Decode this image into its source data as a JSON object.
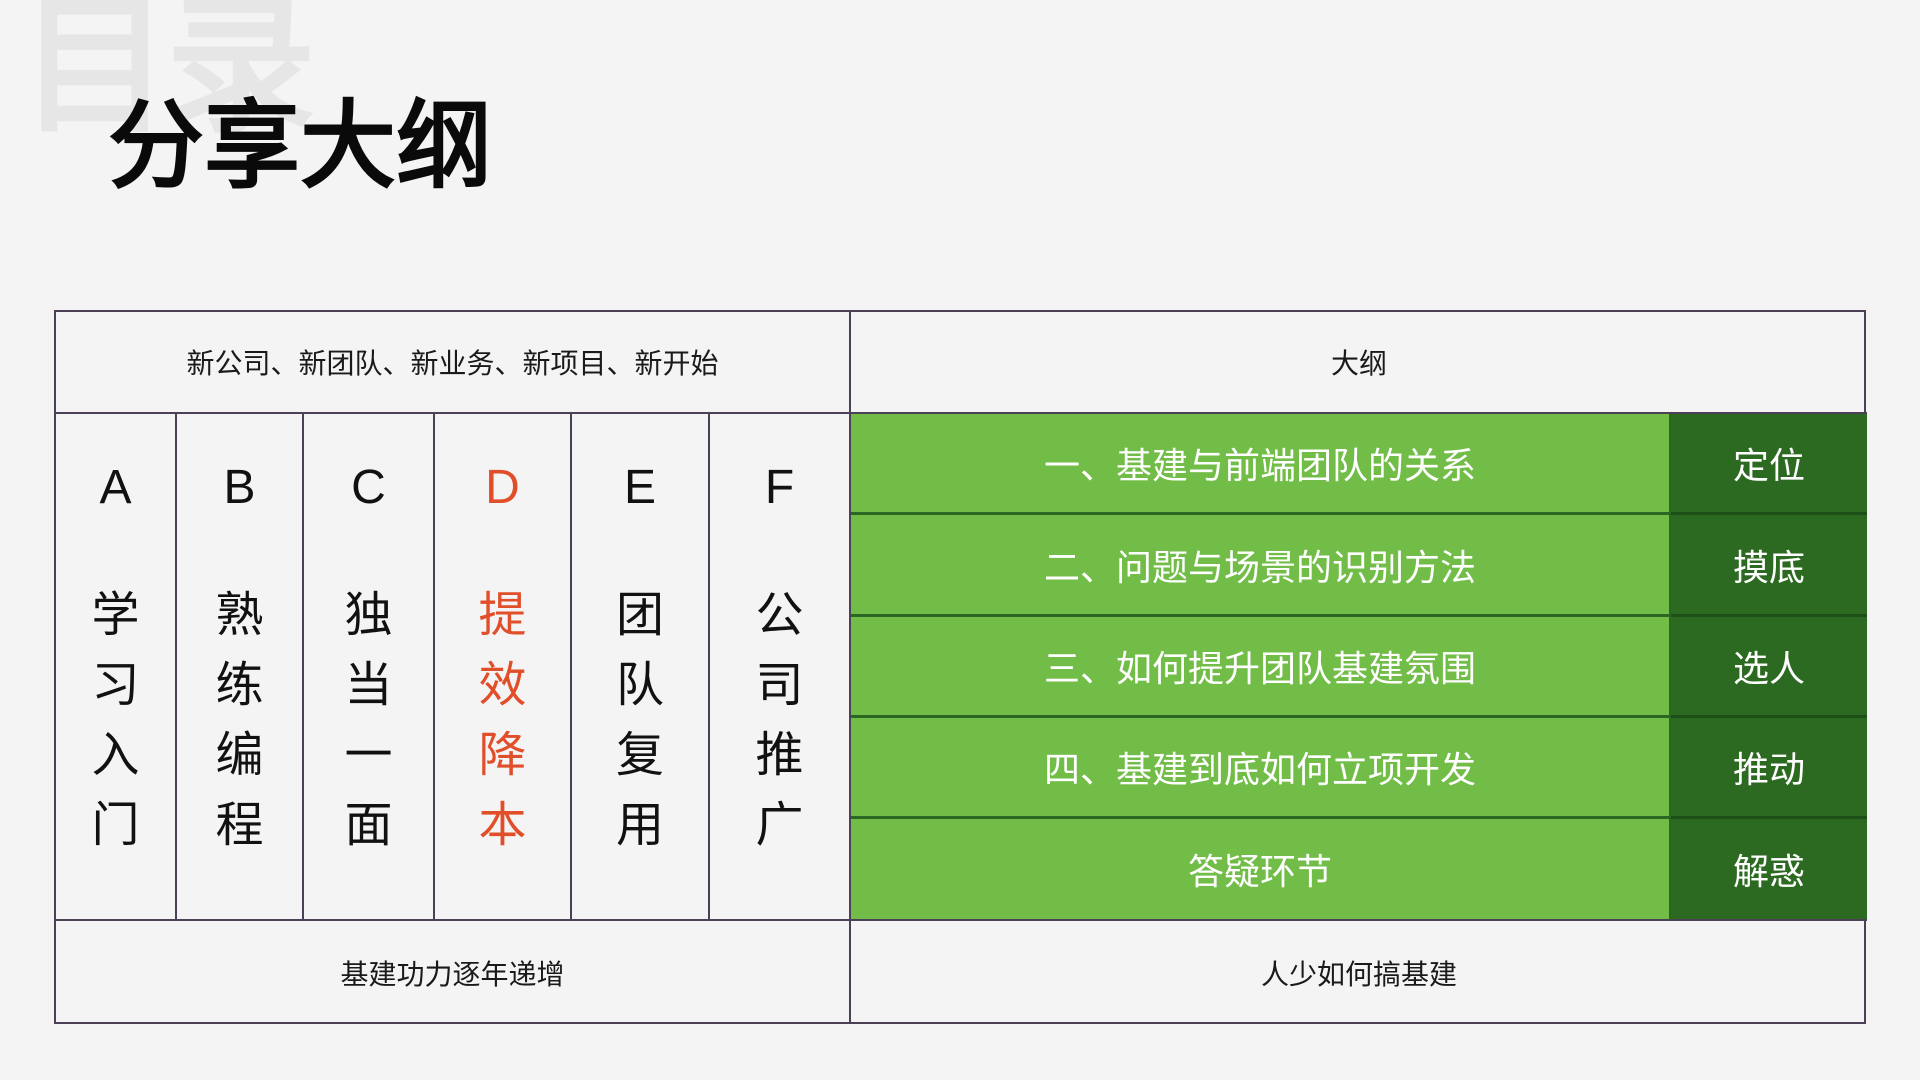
{
  "watermark": "目录",
  "title": "分享大纲",
  "table": {
    "header_left": "新公司、新团队、新业务、新项目、新开始",
    "header_right": "大纲",
    "columns": [
      {
        "letter": "A",
        "chars": [
          "学",
          "习",
          "入",
          "门"
        ],
        "highlight": false
      },
      {
        "letter": "B",
        "chars": [
          "熟",
          "练",
          "编",
          "程"
        ],
        "highlight": false
      },
      {
        "letter": "C",
        "chars": [
          "独",
          "当",
          "一",
          "面"
        ],
        "highlight": false
      },
      {
        "letter": "D",
        "chars": [
          "提",
          "效",
          "降",
          "本"
        ],
        "highlight": true
      },
      {
        "letter": "E",
        "chars": [
          "团",
          "队",
          "复",
          "用"
        ],
        "highlight": false
      },
      {
        "letter": "F",
        "chars": [
          "公",
          "司",
          "推",
          "广"
        ],
        "highlight": false
      }
    ],
    "outline": [
      {
        "text": "一、基建与前端团队的关系",
        "tag": "定位"
      },
      {
        "text": "二、问题与场景的识别方法",
        "tag": "摸底"
      },
      {
        "text": "三、如何提升团队基建氛围",
        "tag": "选人"
      },
      {
        "text": "四、基建到底如何立项开发",
        "tag": "推动"
      },
      {
        "text": "答疑环节",
        "tag": "解惑"
      }
    ],
    "footer_left": "基建功力逐年递增",
    "footer_right": "人少如何搞基建"
  },
  "colors": {
    "background": "#f5f4f5",
    "outline_green": "#72bd48",
    "tag_dark_green": "#2c6a21",
    "highlight_red": "#e04f2a",
    "border": "#4c4056"
  }
}
